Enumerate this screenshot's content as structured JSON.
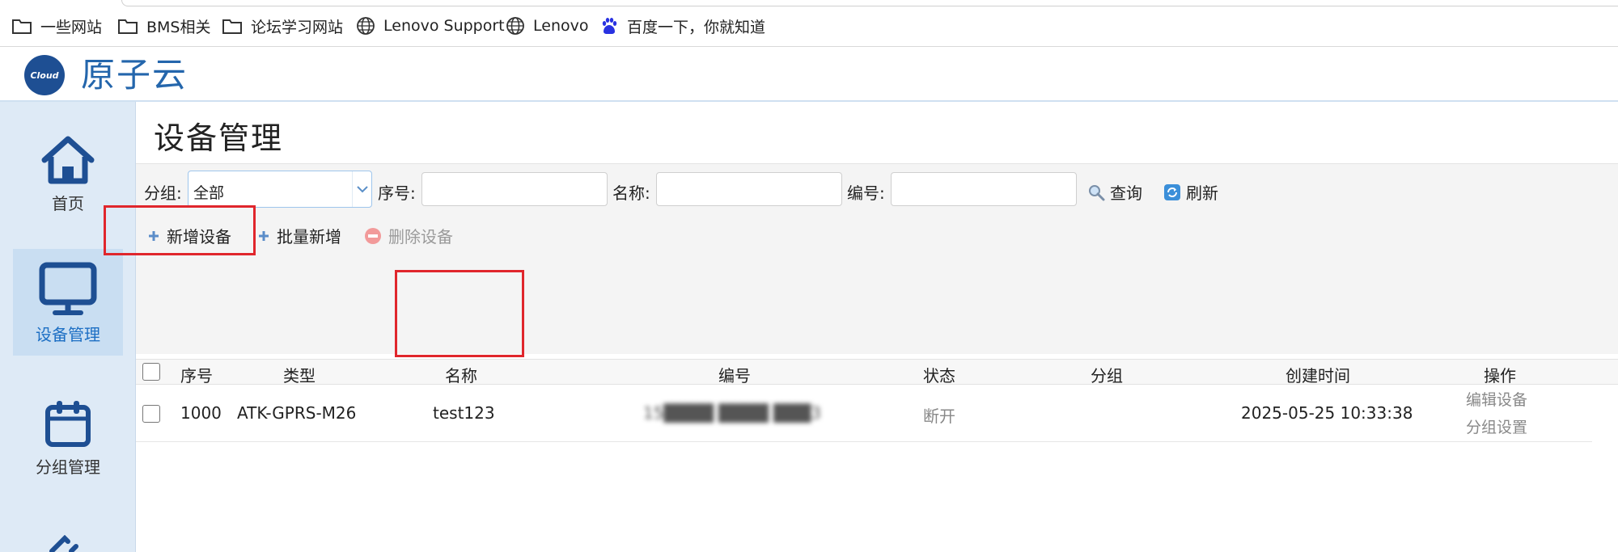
{
  "bookmarks": [
    {
      "label": "一些网站",
      "icon": "folder-icon"
    },
    {
      "label": "BMS相关",
      "icon": "folder-icon"
    },
    {
      "label": "论坛学习网站",
      "icon": "folder-icon"
    },
    {
      "label": "Lenovo Support",
      "icon": "globe-icon"
    },
    {
      "label": "Lenovo",
      "icon": "globe-icon"
    },
    {
      "label": "百度一下，你就知道",
      "icon": "baidu-paw-icon"
    }
  ],
  "app": {
    "logo_badge": "Cloud",
    "title": "原子云"
  },
  "sidebar": {
    "items": [
      {
        "label": "首页",
        "icon": "home-icon",
        "active": false
      },
      {
        "label": "设备管理",
        "icon": "monitor-icon",
        "active": true
      },
      {
        "label": "分组管理",
        "icon": "calendar-icon",
        "active": false
      }
    ]
  },
  "page": {
    "title": "设备管理"
  },
  "filters": {
    "group_label": "分组:",
    "group_value": "全部",
    "serial_label": "序号:",
    "serial_value": "",
    "name_label": "名称:",
    "name_value": "",
    "code_label": "编号:",
    "code_value": "",
    "query_label": "查询",
    "refresh_label": "刷新"
  },
  "actions": {
    "add_label": "新增设备",
    "batch_add_label": "批量新增",
    "delete_label": "删除设备"
  },
  "table": {
    "columns": [
      "序号",
      "类型",
      "名称",
      "编号",
      "状态",
      "分组",
      "创建时间",
      "操作"
    ],
    "rows": [
      {
        "serial": "1000",
        "type": "ATK-GPRS-M26",
        "name": "test123",
        "code": "15████ ████ ███3",
        "status": "断开",
        "group": "",
        "created": "2025-05-25 10:33:38",
        "ops": [
          "编辑设备",
          "分组设置"
        ]
      }
    ]
  },
  "colors": {
    "accent": "#1d6fc4",
    "logo": "#1e4f93",
    "highlight": "#e0262c",
    "sidebar_bg": "#deeaf6"
  }
}
